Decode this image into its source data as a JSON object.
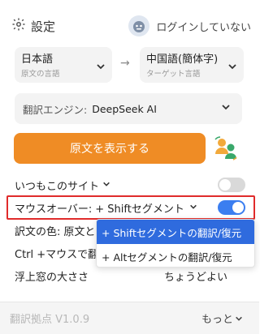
{
  "header": {
    "title": "設定",
    "login": "ログインしていない"
  },
  "languages": {
    "source_lang": "日本語",
    "source_sub": "原文の言語",
    "target_lang": "中国語(簡体字)",
    "target_sub": "ターゲット言語"
  },
  "engine": {
    "label": "翻訳エンジン:",
    "value": "DeepSeek AI"
  },
  "main_button": "原文を表示する",
  "settings": {
    "always_site": "いつもこのサイト",
    "mouseover_label": "マウスオーバー:",
    "mouseover_value": "+ Shiftセグメント",
    "color_label": "訳文の色:",
    "color_value": "原文と",
    "ctrl_label": "Ctrl +マウスで翻",
    "float_label": "浮上窓の大ささ",
    "float_value": "ちょうどよい"
  },
  "dropdown": {
    "options": [
      "+ Shiftセグメントの翻訳/復元",
      "+ Altセグメントの翻訳/復元"
    ]
  },
  "footer": {
    "version": "翻訳拠点 V1.0.9",
    "more": "もっと"
  },
  "colors": {
    "accent_orange": "#ef8c25",
    "toggle_blue": "#3b7ef0",
    "highlight_red": "#e02b2b",
    "dropdown_selected": "#2f6bde"
  }
}
